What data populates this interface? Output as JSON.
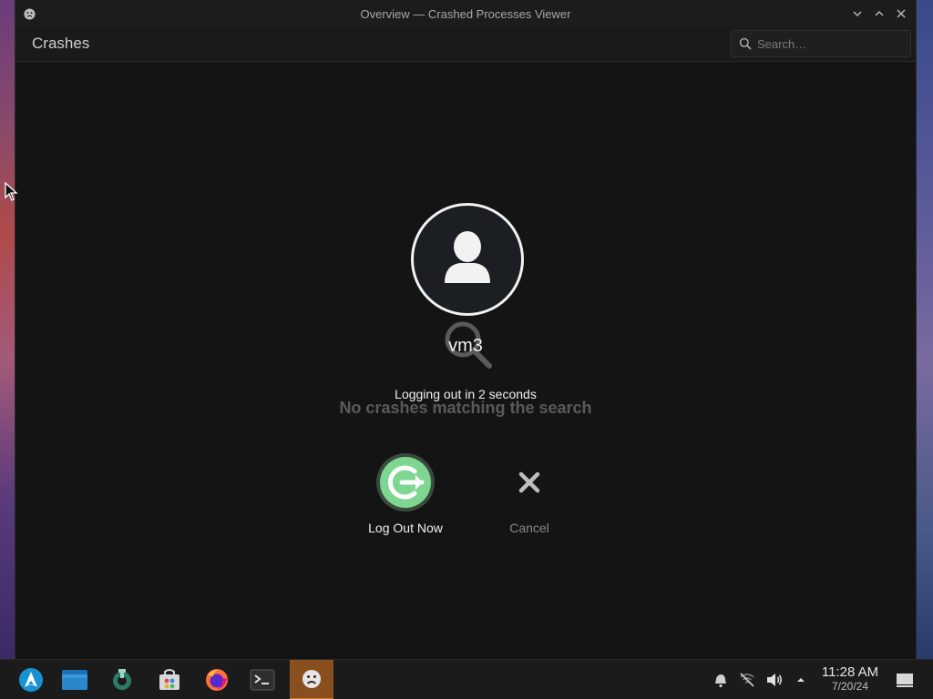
{
  "window": {
    "title": "Overview — Crashed Processes Viewer"
  },
  "toolbar": {
    "heading": "Crashes",
    "search_placeholder": "Search…",
    "search_value": ""
  },
  "empty_state": {
    "message": "No crashes matching the search"
  },
  "logout_dialog": {
    "username": "vm3",
    "countdown": "Logging out in 2 seconds",
    "logout_label": "Log Out Now",
    "cancel_label": "Cancel",
    "logout_color": "#7ed690"
  },
  "taskbar": {
    "items": [
      {
        "name": "application-launcher",
        "icon": "arch-logo-icon"
      },
      {
        "name": "file-manager",
        "icon": "folder-icon"
      },
      {
        "name": "system-settings",
        "icon": "wrench-gear-icon"
      },
      {
        "name": "discover-store",
        "icon": "shopping-bag-icon"
      },
      {
        "name": "firefox",
        "icon": "firefox-icon"
      },
      {
        "name": "terminal",
        "icon": "terminal-icon"
      },
      {
        "name": "crashed-processes-viewer",
        "icon": "sad-face-icon",
        "active": true
      }
    ],
    "tray": [
      "notifications-icon",
      "network-disconnected-icon",
      "volume-icon",
      "expand-tray-icon"
    ],
    "clock": {
      "time": "11:28 AM",
      "date": "7/20/24"
    },
    "accent_color": "#8a4f1e"
  }
}
